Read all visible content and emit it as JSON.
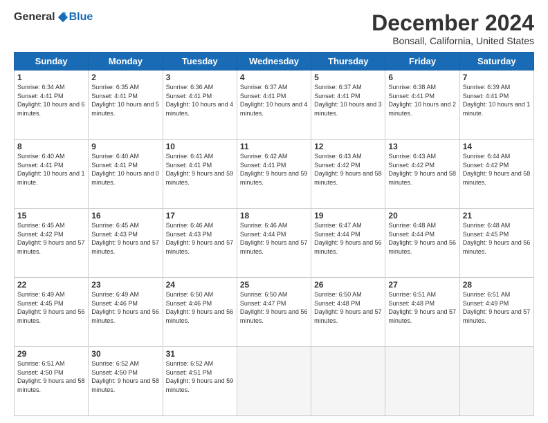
{
  "header": {
    "logo_general": "General",
    "logo_blue": "Blue",
    "month_title": "December 2024",
    "location": "Bonsall, California, United States"
  },
  "days_of_week": [
    "Sunday",
    "Monday",
    "Tuesday",
    "Wednesday",
    "Thursday",
    "Friday",
    "Saturday"
  ],
  "weeks": [
    [
      {
        "day": 1,
        "sunrise": "6:34 AM",
        "sunset": "4:41 PM",
        "daylight": "10 hours and 6 minutes."
      },
      {
        "day": 2,
        "sunrise": "6:35 AM",
        "sunset": "4:41 PM",
        "daylight": "10 hours and 5 minutes."
      },
      {
        "day": 3,
        "sunrise": "6:36 AM",
        "sunset": "4:41 PM",
        "daylight": "10 hours and 4 minutes."
      },
      {
        "day": 4,
        "sunrise": "6:37 AM",
        "sunset": "4:41 PM",
        "daylight": "10 hours and 4 minutes."
      },
      {
        "day": 5,
        "sunrise": "6:37 AM",
        "sunset": "4:41 PM",
        "daylight": "10 hours and 3 minutes."
      },
      {
        "day": 6,
        "sunrise": "6:38 AM",
        "sunset": "4:41 PM",
        "daylight": "10 hours and 2 minutes."
      },
      {
        "day": 7,
        "sunrise": "6:39 AM",
        "sunset": "4:41 PM",
        "daylight": "10 hours and 1 minute."
      }
    ],
    [
      {
        "day": 8,
        "sunrise": "6:40 AM",
        "sunset": "4:41 PM",
        "daylight": "10 hours and 1 minute."
      },
      {
        "day": 9,
        "sunrise": "6:40 AM",
        "sunset": "4:41 PM",
        "daylight": "10 hours and 0 minutes."
      },
      {
        "day": 10,
        "sunrise": "6:41 AM",
        "sunset": "4:41 PM",
        "daylight": "9 hours and 59 minutes."
      },
      {
        "day": 11,
        "sunrise": "6:42 AM",
        "sunset": "4:41 PM",
        "daylight": "9 hours and 59 minutes."
      },
      {
        "day": 12,
        "sunrise": "6:43 AM",
        "sunset": "4:42 PM",
        "daylight": "9 hours and 58 minutes."
      },
      {
        "day": 13,
        "sunrise": "6:43 AM",
        "sunset": "4:42 PM",
        "daylight": "9 hours and 58 minutes."
      },
      {
        "day": 14,
        "sunrise": "6:44 AM",
        "sunset": "4:42 PM",
        "daylight": "9 hours and 58 minutes."
      }
    ],
    [
      {
        "day": 15,
        "sunrise": "6:45 AM",
        "sunset": "4:42 PM",
        "daylight": "9 hours and 57 minutes."
      },
      {
        "day": 16,
        "sunrise": "6:45 AM",
        "sunset": "4:43 PM",
        "daylight": "9 hours and 57 minutes."
      },
      {
        "day": 17,
        "sunrise": "6:46 AM",
        "sunset": "4:43 PM",
        "daylight": "9 hours and 57 minutes."
      },
      {
        "day": 18,
        "sunrise": "6:46 AM",
        "sunset": "4:44 PM",
        "daylight": "9 hours and 57 minutes."
      },
      {
        "day": 19,
        "sunrise": "6:47 AM",
        "sunset": "4:44 PM",
        "daylight": "9 hours and 56 minutes."
      },
      {
        "day": 20,
        "sunrise": "6:48 AM",
        "sunset": "4:44 PM",
        "daylight": "9 hours and 56 minutes."
      },
      {
        "day": 21,
        "sunrise": "6:48 AM",
        "sunset": "4:45 PM",
        "daylight": "9 hours and 56 minutes."
      }
    ],
    [
      {
        "day": 22,
        "sunrise": "6:49 AM",
        "sunset": "4:45 PM",
        "daylight": "9 hours and 56 minutes."
      },
      {
        "day": 23,
        "sunrise": "6:49 AM",
        "sunset": "4:46 PM",
        "daylight": "9 hours and 56 minutes."
      },
      {
        "day": 24,
        "sunrise": "6:50 AM",
        "sunset": "4:46 PM",
        "daylight": "9 hours and 56 minutes."
      },
      {
        "day": 25,
        "sunrise": "6:50 AM",
        "sunset": "4:47 PM",
        "daylight": "9 hours and 56 minutes."
      },
      {
        "day": 26,
        "sunrise": "6:50 AM",
        "sunset": "4:48 PM",
        "daylight": "9 hours and 57 minutes."
      },
      {
        "day": 27,
        "sunrise": "6:51 AM",
        "sunset": "4:48 PM",
        "daylight": "9 hours and 57 minutes."
      },
      {
        "day": 28,
        "sunrise": "6:51 AM",
        "sunset": "4:49 PM",
        "daylight": "9 hours and 57 minutes."
      }
    ],
    [
      {
        "day": 29,
        "sunrise": "6:51 AM",
        "sunset": "4:50 PM",
        "daylight": "9 hours and 58 minutes."
      },
      {
        "day": 30,
        "sunrise": "6:52 AM",
        "sunset": "4:50 PM",
        "daylight": "9 hours and 58 minutes."
      },
      {
        "day": 31,
        "sunrise": "6:52 AM",
        "sunset": "4:51 PM",
        "daylight": "9 hours and 59 minutes."
      },
      null,
      null,
      null,
      null
    ]
  ]
}
